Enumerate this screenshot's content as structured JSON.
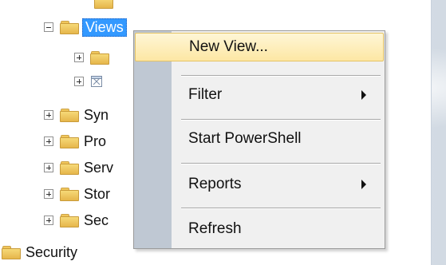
{
  "tree": {
    "selected_node": "Views",
    "nodes": [
      {
        "label": "Views",
        "expanded": true,
        "selected": true
      },
      {
        "label": "",
        "expanded": false
      },
      {
        "label": "",
        "expanded": false,
        "icon": "system-object-icon"
      },
      {
        "label": "Syn",
        "expanded": false
      },
      {
        "label": "Pro",
        "expanded": false
      },
      {
        "label": "Serv",
        "expanded": false
      },
      {
        "label": "Stor",
        "expanded": false
      },
      {
        "label": "Sec",
        "expanded": false
      },
      {
        "label": "Security",
        "expanded": false
      }
    ]
  },
  "context_menu": {
    "items": [
      {
        "label": "New View...",
        "has_submenu": false,
        "highlighted": true
      },
      {
        "label": "Filter",
        "has_submenu": true,
        "highlighted": false
      },
      {
        "label": "Start PowerShell",
        "has_submenu": false,
        "highlighted": false
      },
      {
        "label": "Reports",
        "has_submenu": true,
        "highlighted": false
      },
      {
        "label": "Refresh",
        "has_submenu": false,
        "highlighted": false
      }
    ]
  },
  "colors": {
    "selection": "#3399ff",
    "menu_background": "#f0f0f0",
    "menu_gutter": "#bfc8d3",
    "menu_highlight": "#fde7a4",
    "folder": "#f0c65b"
  }
}
